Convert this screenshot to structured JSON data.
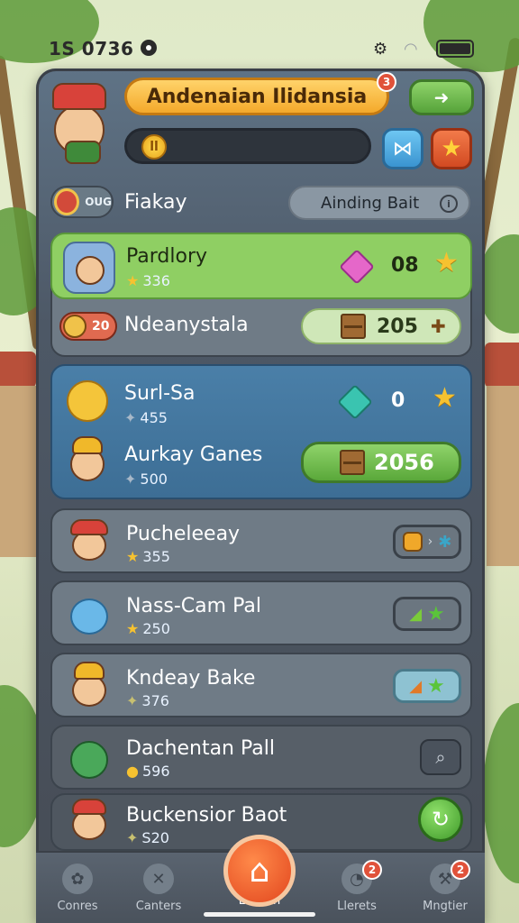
{
  "status_bar": {
    "time": "1S 0736"
  },
  "header": {
    "title": "Andenaian Ilidansia",
    "title_badge": "3",
    "progress_coin_label": "ll"
  },
  "filter": {
    "badge_text": "OUG",
    "label": "Fiakay",
    "dropdown": "Ainding Bait"
  },
  "rows": [
    {
      "name": "Pardlory",
      "score": "336",
      "count": "08"
    },
    {
      "badge_value": "20",
      "name": "Ndeanystala",
      "reward": "205"
    },
    {
      "name": "Surl-Sa",
      "score": "455",
      "count": "0"
    },
    {
      "name": "Aurkay Ganes",
      "score": "500",
      "reward": "2056"
    },
    {
      "name": "Pucheleeay",
      "score": "355"
    },
    {
      "name": "Nass-Cam Pal",
      "score": "250"
    },
    {
      "name": "Kndeay Bake",
      "score": "376"
    },
    {
      "name": "Dachentan Pall",
      "score": "596"
    },
    {
      "name": "Buckensior Baot",
      "score": "S20"
    }
  ],
  "tabs": [
    {
      "label": "Conres"
    },
    {
      "label": "Canters"
    },
    {
      "label": "Lusdan"
    },
    {
      "label": "Llerets",
      "badge": "2"
    },
    {
      "label": "Mngtier",
      "badge": "2"
    }
  ],
  "colors": {
    "accent_orange": "#f4a92b",
    "green": "#8fd36a",
    "highlight_row": "#8fcf63",
    "blue_row": "#3d6e95"
  }
}
